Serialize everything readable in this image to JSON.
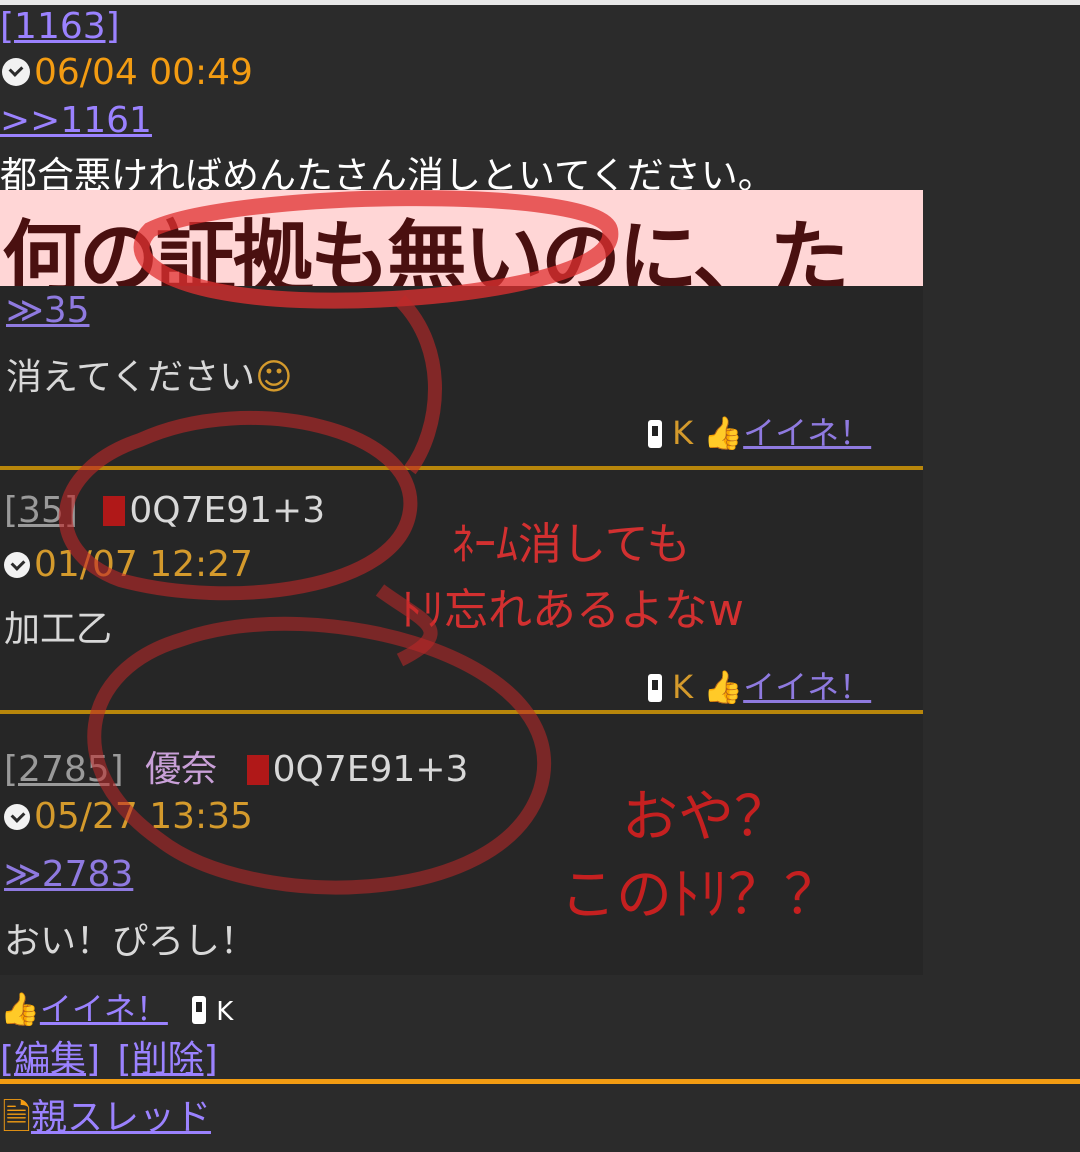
{
  "post": {
    "number": "[1163]",
    "timestamp": "06/04 00:49",
    "reply_ref": ">>1161",
    "message": "都合悪ければめんたさん消しといてください。"
  },
  "embedded_image": {
    "banner_text": "何の証拠も無いのに、ただ",
    "entries": [
      {
        "reply_ref": "≫35",
        "message": "消えてください",
        "carrier": "K",
        "like_label": "イイネ！"
      },
      {
        "number": "[35]",
        "trip": "0Q7E91+3",
        "timestamp": "01/07 12:27",
        "message": "加工乙",
        "carrier": "K",
        "like_label": "イイネ！"
      },
      {
        "number": "[2785]",
        "name": "優奈",
        "trip": "0Q7E91+3",
        "timestamp": "05/27 13:35",
        "reply_ref": "≫2783",
        "message": "おい！ぴろし！"
      }
    ],
    "annotations": {
      "note1_line1": "ﾈｰﾑ消しても",
      "note1_line2": "ﾄﾘ忘れあるよなw",
      "note2_line1": "おや？",
      "note2_line2": "このﾄﾘ？？"
    },
    "colors": {
      "circle": "#e03030",
      "annotation": "#d23030"
    }
  },
  "actions": {
    "like_label": "イイネ！",
    "carrier": "K",
    "edit_label": "[編集]",
    "delete_label": "[削除]"
  },
  "footer": {
    "parent_thread_label": "親スレッド"
  },
  "colors": {
    "background": "#2b2b2b",
    "link": "#9b82ff",
    "accent": "#f39c12"
  }
}
